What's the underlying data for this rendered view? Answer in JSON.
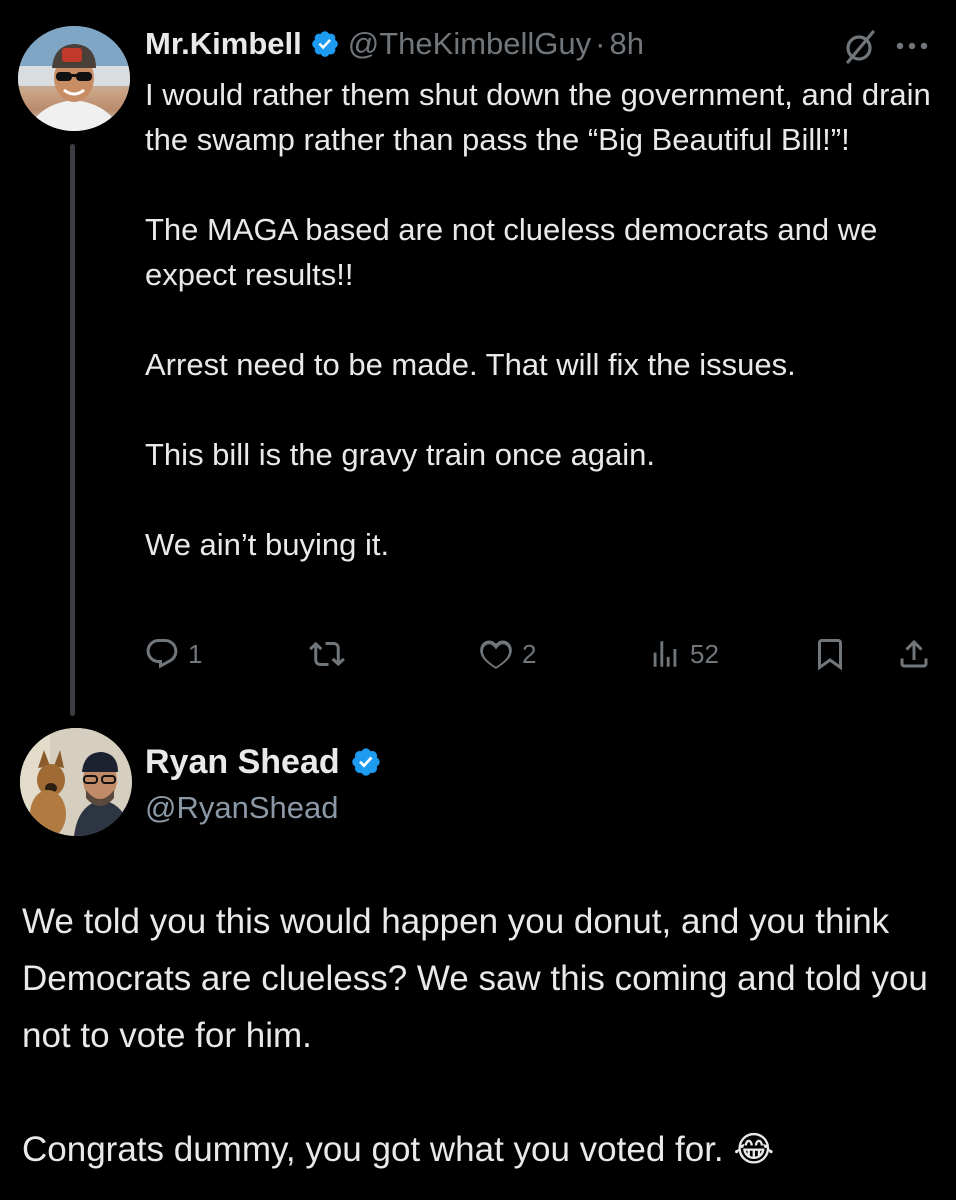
{
  "original_tweet": {
    "author_name": "Mr.Kimbell",
    "handle": "@TheKimbellGuy",
    "separator": "·",
    "time": "8h",
    "paragraphs": [
      "I would rather them shut down the government, and drain the swamp rather than pass the “Big Beautiful Bill!”!",
      "The MAGA based are not clueless democrats and we expect results!!",
      "Arrest need to be made. That will fix the issues.",
      "This bill is the gravy train once again.",
      "We ain’t buying it."
    ],
    "actions": {
      "replies": "1",
      "likes": "2",
      "views": "52"
    }
  },
  "reply_tweet": {
    "author_name": "Ryan Shead",
    "handle": "@RyanShead",
    "paragraphs": [
      "We told you this would happen you donut, and you think Democrats are clueless? We saw this coming and told you not to vote for him.",
      "Congrats dummy, you got what you voted for. 😂"
    ]
  },
  "colors": {
    "background": "#000000",
    "text": "#e7e9ea",
    "muted": "#71767b",
    "verified": "#1d9bf0",
    "thread_line": "#3a3d41"
  },
  "icons": [
    "verified-badge-icon",
    "grok-icon",
    "more-icon",
    "reply-icon",
    "repost-icon",
    "like-icon",
    "views-icon",
    "bookmark-icon",
    "share-icon",
    "laughing-emoji"
  ]
}
